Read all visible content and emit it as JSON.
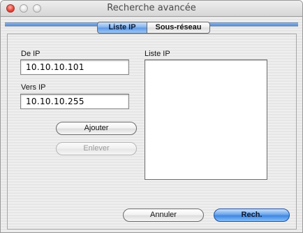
{
  "window": {
    "title": "Recherche avancée"
  },
  "tabs": [
    {
      "label": "Liste IP",
      "selected": true
    },
    {
      "label": "Sous-réseau",
      "selected": false
    }
  ],
  "form": {
    "from_label": "De IP",
    "from_value": "10.10.10.101",
    "to_label": "Vers IP",
    "to_value": "10.10.10.255",
    "list_label": "Liste IP",
    "list_items": []
  },
  "buttons": {
    "add": "Ajouter",
    "remove": "Enlever",
    "cancel": "Annuler",
    "search": "Rech."
  },
  "colors": {
    "accent": "#5c97e4",
    "close": "#e8453a"
  }
}
